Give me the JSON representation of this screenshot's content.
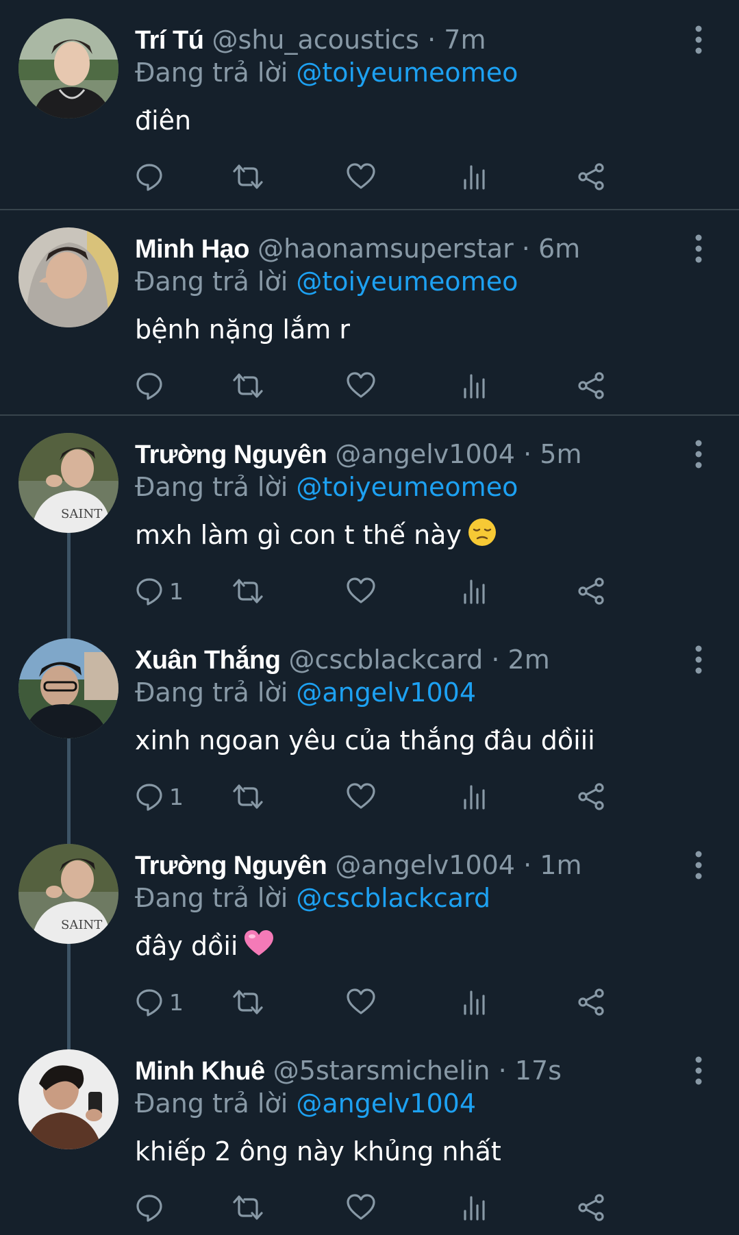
{
  "reply_prefix": "Đang trả lời",
  "tweets": [
    {
      "name": "Trí Tú",
      "handle": "@shu_acoustics",
      "sep": "·",
      "time": "7m",
      "reply_to": "@toiyeumeomeo",
      "text": "điên",
      "reply_count": "",
      "emoji": ""
    },
    {
      "name": "Minh Hạo",
      "handle": "@haonamsuperstar",
      "sep": "·",
      "time": "6m",
      "reply_to": "@toiyeumeomeo",
      "text": "bệnh nặng lắm r",
      "reply_count": "",
      "emoji": ""
    },
    {
      "name": "Trường Nguyên",
      "handle": "@angelv1004",
      "sep": "·",
      "time": "5m",
      "reply_to": "@toiyeumeomeo",
      "text": "mxh làm gì con t thế này",
      "reply_count": "1",
      "emoji": "pensive-face"
    },
    {
      "name": "Xuân Thắng",
      "handle": "@cscblackcard",
      "sep": "·",
      "time": "2m",
      "reply_to": "@angelv1004",
      "text": "xinh ngoan yêu của thắng đâu dồiii",
      "reply_count": "1",
      "emoji": ""
    },
    {
      "name": "Trường Nguyên",
      "handle": "@angelv1004",
      "sep": "·",
      "time": "1m",
      "reply_to": "@cscblackcard",
      "text": "đây dồii",
      "reply_count": "1",
      "emoji": "pink-heart"
    },
    {
      "name": "Minh Khuê",
      "handle": "@5starsmichelin",
      "sep": "·",
      "time": "17s",
      "reply_to": "@angelv1004",
      "text": "khiếp 2 ông này khủng nhất",
      "reply_count": "",
      "emoji": ""
    }
  ],
  "colors": {
    "background": "#15202b",
    "secondary_text": "#8899a6",
    "link": "#1da1f2",
    "divider": "#38444d",
    "thread_line": "#3d5466"
  },
  "icons": [
    "reply-icon",
    "retweet-icon",
    "like-icon",
    "analytics-icon",
    "share-icon",
    "more-options-icon"
  ]
}
